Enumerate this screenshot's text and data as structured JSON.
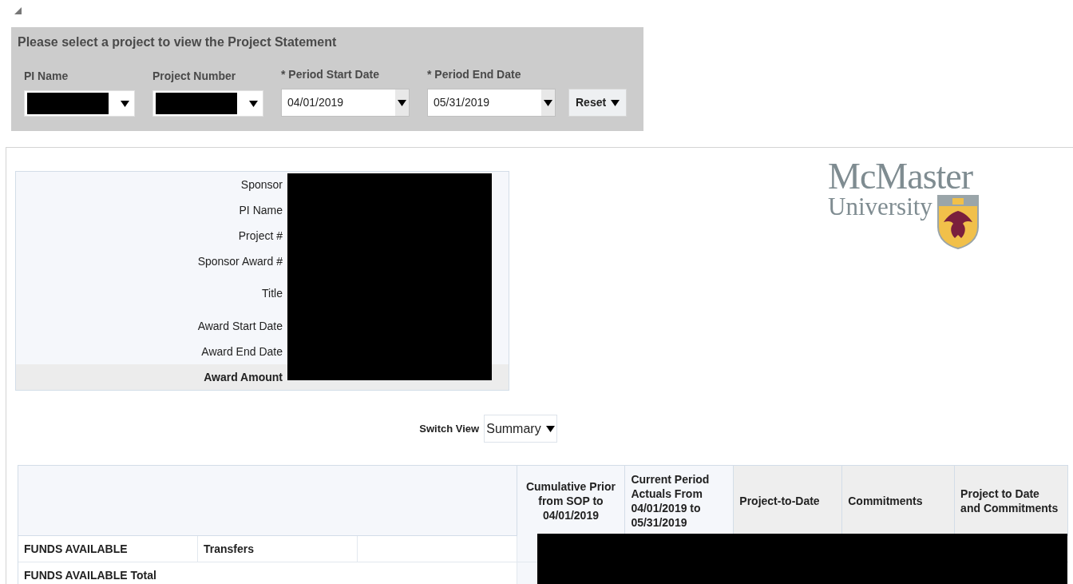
{
  "filter_panel": {
    "title": "Please select a project to view the Project Statement",
    "fields": [
      {
        "label": "PI Name",
        "kind": "redacted"
      },
      {
        "label": "Project Number",
        "kind": "redacted"
      },
      {
        "label": "* Period Start Date",
        "kind": "date",
        "value": "04/01/2019"
      },
      {
        "label": "* Period End Date",
        "kind": "date",
        "value": "05/31/2019"
      }
    ],
    "reset_button": "Reset"
  },
  "logo": {
    "line_1": "McMaster",
    "line_2": "University"
  },
  "project_info": {
    "rows": [
      {
        "label": "Sponsor",
        "emphasized": false
      },
      {
        "label": "PI Name",
        "emphasized": false
      },
      {
        "label": "Project #",
        "emphasized": false
      },
      {
        "label": "Sponsor Award #",
        "emphasized": false
      },
      {
        "label": "Title",
        "emphasized": false
      },
      {
        "label": "Award Start Date",
        "emphasized": false
      },
      {
        "label": "Award End Date",
        "emphasized": false
      },
      {
        "label": "Award Amount",
        "emphasized": true
      }
    ]
  },
  "switch_view": {
    "label": "Switch View",
    "value": "Summary"
  },
  "table": {
    "columns": [
      {
        "label": "Cumulative Prior from SOP to 04/01/2019",
        "shaded": false
      },
      {
        "label": "Current Period Actuals From 04/01/2019 to 05/31/2019",
        "shaded": false
      },
      {
        "label": "Project-to-Date",
        "shaded": true
      },
      {
        "label": "Commitments",
        "shaded": true
      },
      {
        "label": "Project to Date and Commitments",
        "shaded": true
      }
    ],
    "rows": [
      {
        "cells": [
          "FUNDS AVAILABLE",
          "Transfers"
        ]
      },
      {
        "cells": [
          "FUNDS AVAILABLE Total"
        ]
      }
    ]
  }
}
